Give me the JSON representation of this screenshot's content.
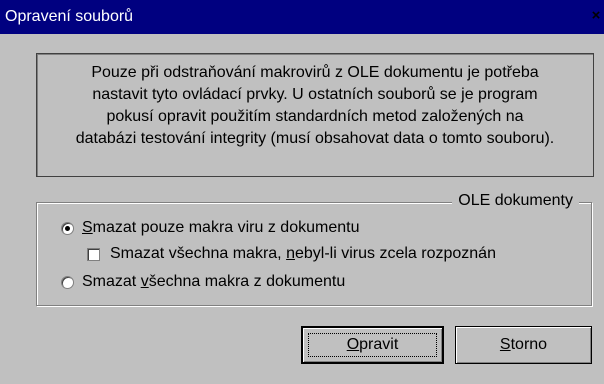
{
  "window": {
    "title": "Opravení souborů",
    "close_glyph": "×"
  },
  "info": {
    "lines": [
      "Pouze při odstraňování makrovirů z OLE dokumentu je potřeba",
      "nastavit tyto ovládací prvky. U ostatních souborů se je program",
      "pokusí opravit použitím standardních metod  založených na",
      "databázi testování integrity (musí obsahovat data o tomto souboru)."
    ]
  },
  "group": {
    "legend": "OLE dokumenty",
    "options": {
      "opt1_pre": "",
      "opt1_u": "S",
      "opt1_post": "mazat pouze makra viru z dokumentu",
      "opt1_checked": true,
      "check_pre": "Smazat všechna makra, ",
      "check_u": "n",
      "check_post": "ebyl-li virus zcela rozpoznán",
      "check_checked": false,
      "opt2_pre": "Smazat ",
      "opt2_u": "v",
      "opt2_post": "šechna makra z dokumentu",
      "opt2_checked": false
    }
  },
  "buttons": {
    "ok_u": "O",
    "ok_post": "pravit",
    "cancel_u": "S",
    "cancel_post": "torno"
  },
  "colors": {
    "titlebar": "#000080",
    "face": "#c0c0c0"
  }
}
